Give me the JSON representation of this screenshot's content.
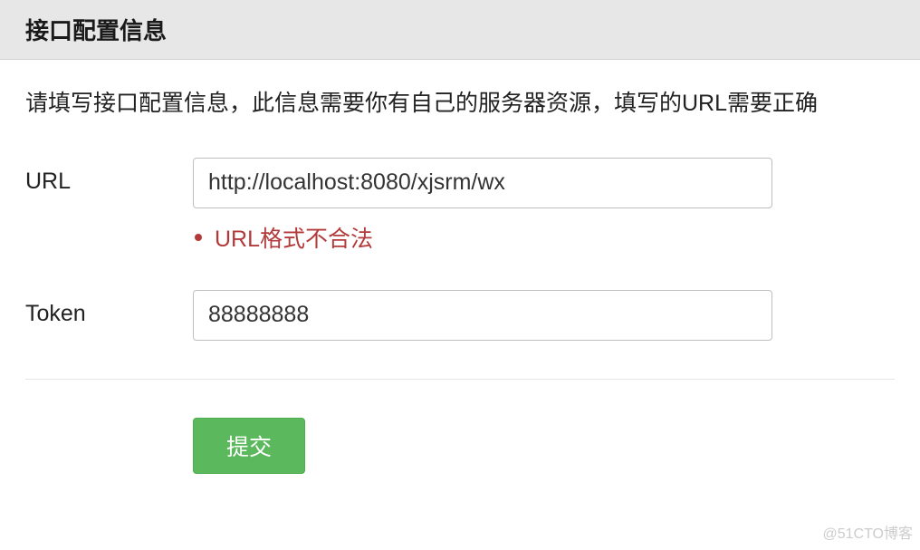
{
  "header": {
    "title": "接口配置信息"
  },
  "instructions": "请填写接口配置信息，此信息需要你有自己的服务器资源，填写的URL需要正确",
  "form": {
    "url": {
      "label": "URL",
      "value": "http://localhost:8080/xjsrm/wx",
      "error": "URL格式不合法"
    },
    "token": {
      "label": "Token",
      "value": "88888888"
    },
    "submit_label": "提交"
  },
  "watermark": "@51CTO博客"
}
